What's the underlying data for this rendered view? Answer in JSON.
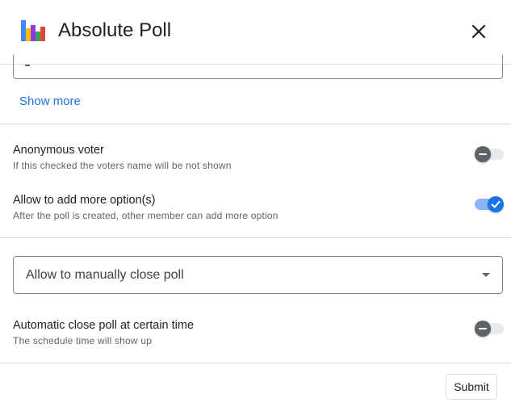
{
  "app": {
    "title": "Absolute Poll",
    "logo_icon": "bar-chart-logo-icon",
    "close_icon": "close-icon"
  },
  "colors": {
    "accent": "#1a73e8",
    "toggle_on_track": "#8ab4f8",
    "toggle_off_thumb": "#5f6368",
    "logo_bars": [
      "#4285f4",
      "#fbbc04",
      "#34a853",
      "#ea4335",
      "#9334e6"
    ]
  },
  "show_more": {
    "label": "Show more"
  },
  "settings": {
    "anonymous": {
      "title": "Anonymous voter",
      "description": "If this checked the voters name will be not shown",
      "enabled": false
    },
    "add_options": {
      "title": "Allow to add more option(s)",
      "description": "After the poll is created, other member can add more option",
      "enabled": true
    },
    "auto_close": {
      "title": "Automatic close poll at certain time",
      "description": "The schedule time will show up",
      "enabled": false
    }
  },
  "close_mode": {
    "selected": "Allow to manually close poll"
  },
  "footer": {
    "submit_label": "Submit"
  }
}
